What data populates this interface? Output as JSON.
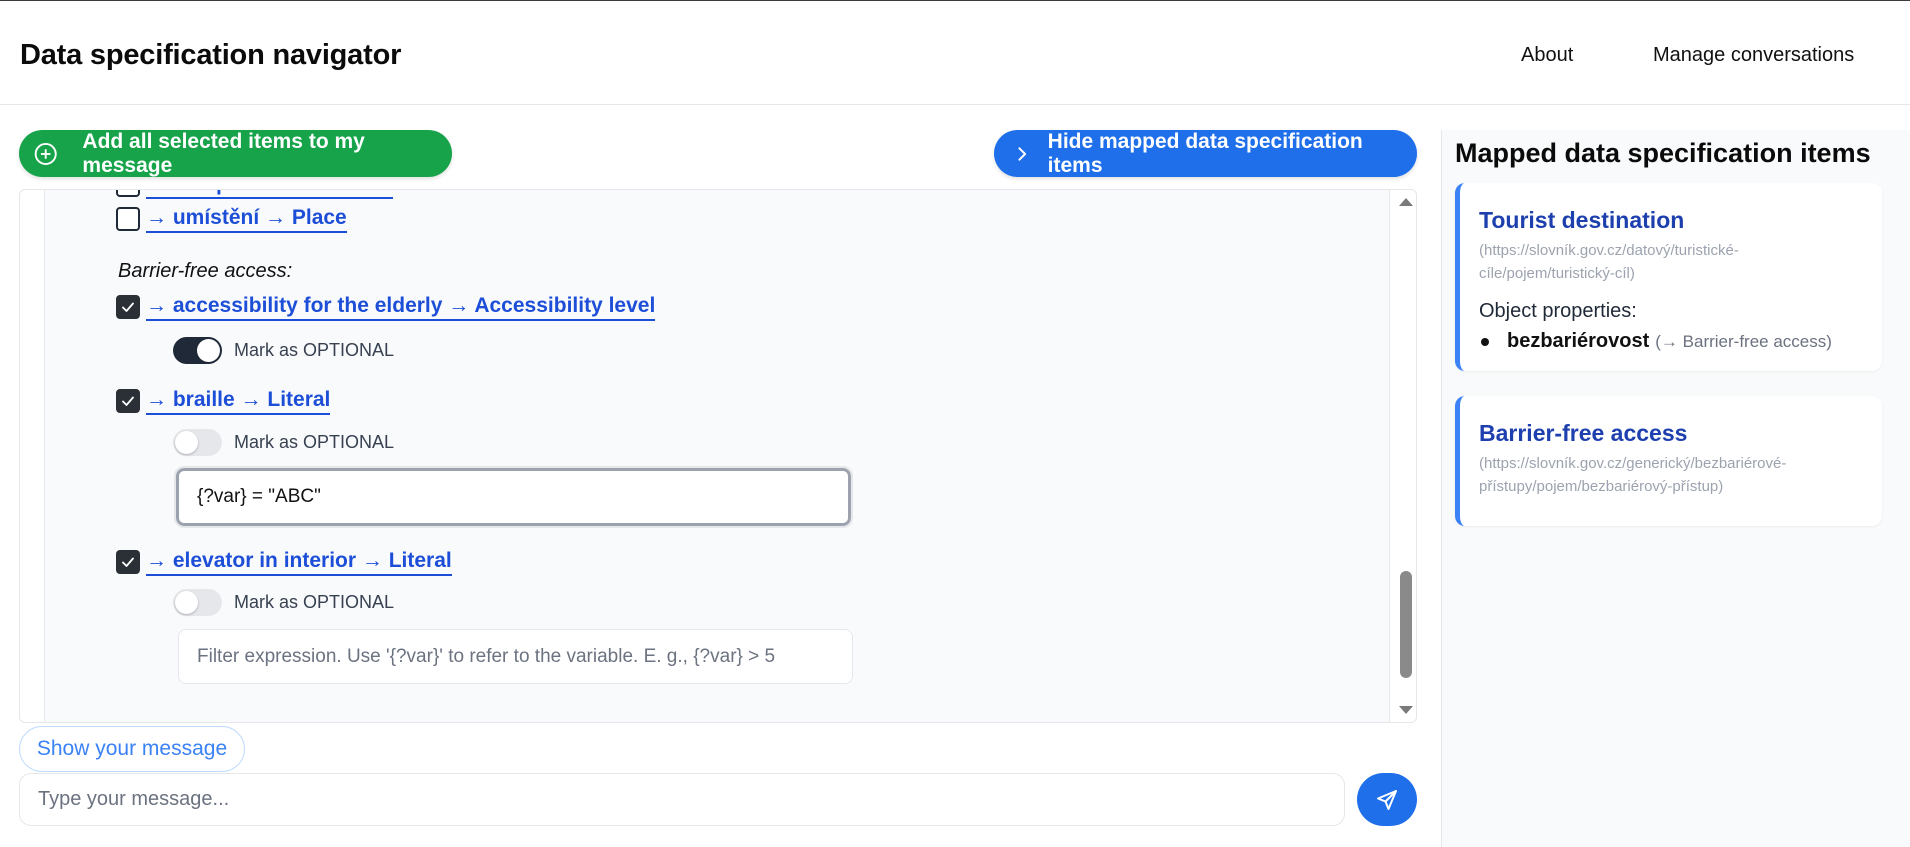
{
  "header": {
    "title": "Data specification navigator",
    "nav": {
      "about": "About",
      "manage": "Manage conversations"
    }
  },
  "toolbar": {
    "add_all_label": "Add all selected items to my message",
    "hide_mapped_label": "Hide mapped data specification items"
  },
  "panel": {
    "items_above": [
      {
        "label": "→ vstupné → Admission",
        "checked": false
      },
      {
        "label": "→ umístění → Place",
        "checked": false
      }
    ],
    "section_title": "Barrier-free access:",
    "items": [
      {
        "label": "→ accessibility for the elderly → Accessibility level",
        "checked": true,
        "optional_label": "Mark as OPTIONAL",
        "optional": true
      },
      {
        "label": "→ braille → Literal",
        "checked": true,
        "optional_label": "Mark as OPTIONAL",
        "optional": false,
        "filter_value": "{?var} = \"ABC\""
      },
      {
        "label": "→ elevator in interior → Literal",
        "checked": true,
        "optional_label": "Mark as OPTIONAL",
        "optional": false,
        "filter_placeholder": "Filter expression. Use '{?var}' to refer to the variable. E. g., {?var} > 5"
      }
    ]
  },
  "composer": {
    "show_message_label": "Show your message",
    "message_placeholder": "Type your message..."
  },
  "sidebar": {
    "title": "Mapped data specification items",
    "cards": [
      {
        "title": "Tourist destination",
        "url": "(https://slovník.gov.cz/datový/turistické-cíle/pojem/turistický-cíl)",
        "props_label": "Object properties:",
        "props": [
          {
            "name": "bezbariérovost",
            "note": "(→ Barrier-free access)"
          }
        ]
      },
      {
        "title": "Barrier-free access",
        "url": "(https://slovník.gov.cz/generický/bezbariérové-přístupy/pojem/bezbariérový-přístup)"
      }
    ]
  },
  "colors": {
    "green": "#16a34a",
    "blue": "#1f6feb",
    "link": "#1d4ed8",
    "card_accent": "#3b82f6"
  }
}
